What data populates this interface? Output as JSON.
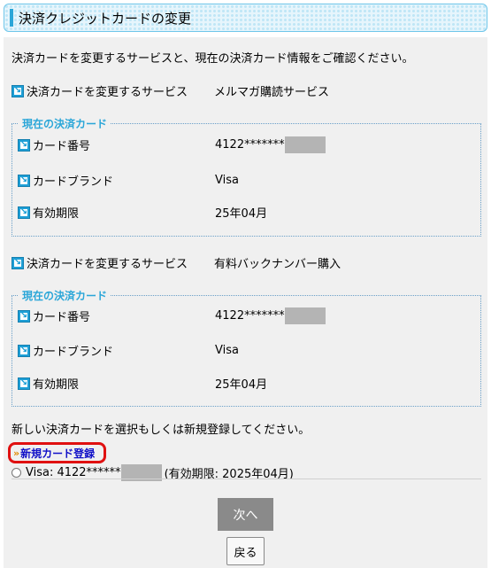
{
  "header": {
    "title": "決済クレジットカードの変更"
  },
  "intro": "決済カードを変更するサービスと、現在の決済カード情報をご確認ください。",
  "services": [
    {
      "service_label": "決済カードを変更するサービス",
      "service_name": "メルマガ購読サービス",
      "legend": "現在の決済カード",
      "rows": [
        {
          "label": "カード番号",
          "value": "4122*******"
        },
        {
          "label": "カードブランド",
          "value": "Visa"
        },
        {
          "label": "有効期限",
          "value": "25年04月"
        }
      ]
    },
    {
      "service_label": "決済カードを変更するサービス",
      "service_name": "有料バックナンバー購入",
      "legend": "現在の決済カード",
      "rows": [
        {
          "label": "カード番号",
          "value": "4122*******"
        },
        {
          "label": "カードブランド",
          "value": "Visa"
        },
        {
          "label": "有効期限",
          "value": "25年04月"
        }
      ]
    }
  ],
  "prompt": "新しい決済カードを選択もしくは新規登録してください。",
  "new_card": {
    "chevron": "»",
    "label": "新規カード登録"
  },
  "card_option": {
    "prefix": "Visa: 4122******",
    "suffix": "(有効期限: 2025年04月)"
  },
  "buttons": {
    "next": "次へ",
    "back": "戻る"
  },
  "colors": {
    "accent": "#2aa6d8",
    "link": "#1010c8",
    "highlight": "#e01010"
  }
}
